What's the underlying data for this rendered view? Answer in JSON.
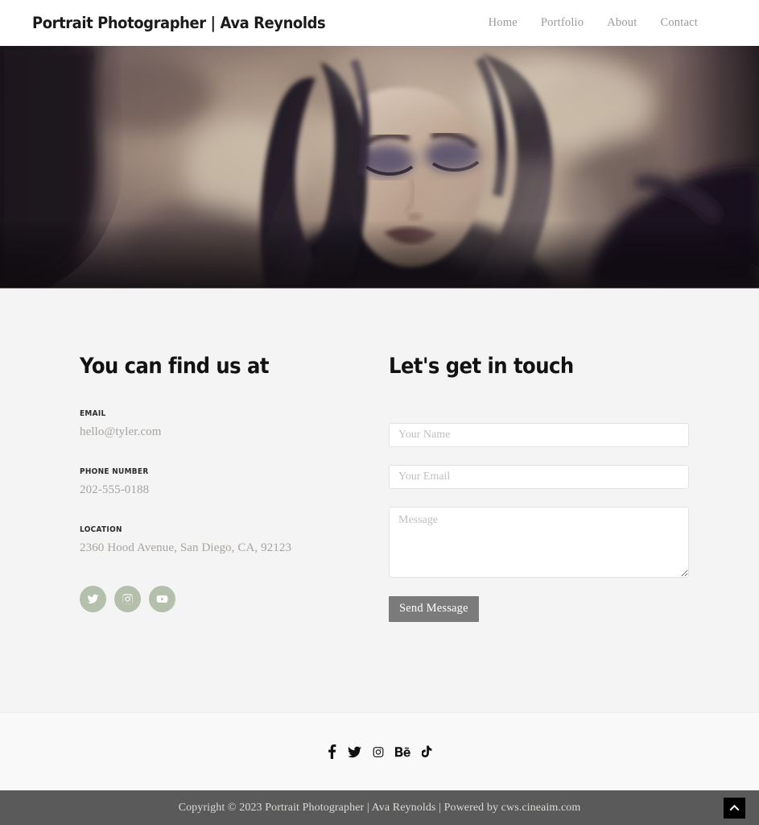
{
  "header": {
    "brand": "Portrait Photographer | Ava Reynolds",
    "nav": [
      {
        "label": "Home"
      },
      {
        "label": "Portfolio"
      },
      {
        "label": "About"
      },
      {
        "label": "Contact"
      }
    ]
  },
  "hero": {
    "alt": "Sepia-toned portrait photograph of a woman with long dark hair and dark eye makeup, eyes closed, surrounded by blurred foliage and dark feathers",
    "palette": {
      "highlight": "#cdb9a2",
      "midtone": "#8e7a6d",
      "shadow": "#3b2f33",
      "deep": "#1a1418"
    }
  },
  "contact": {
    "left": {
      "heading": "You can find us at",
      "items": [
        {
          "label": "EMAIL",
          "value": "hello@tyler.com"
        },
        {
          "label": "PHONE NUMBER",
          "value": "202-555-0188"
        },
        {
          "label": "LOCATION",
          "value": "2360 Hood Avenue, San Diego, CA, 92123"
        }
      ],
      "socials": [
        {
          "name": "twitter-icon",
          "title": "Twitter"
        },
        {
          "name": "instagram-icon",
          "title": "Instagram"
        },
        {
          "name": "youtube-icon",
          "title": "YouTube"
        }
      ],
      "social_circle_color": "#b4bfac"
    },
    "right": {
      "heading": "Let's get in touch",
      "name_placeholder": "Your Name",
      "name_value": "",
      "email_placeholder": "Your Email",
      "email_value": "",
      "message_placeholder": "Message",
      "message_value": "",
      "submit_label": "Send Message",
      "submit_color": "#7b7b7b"
    },
    "background": "#f4f4f4"
  },
  "footer": {
    "socials": [
      {
        "name": "facebook-icon",
        "title": "Facebook"
      },
      {
        "name": "twitter-icon",
        "title": "Twitter"
      },
      {
        "name": "instagram-icon",
        "title": "Instagram"
      },
      {
        "name": "behance-icon",
        "title": "Behance"
      },
      {
        "name": "tiktok-icon",
        "title": "TikTok"
      }
    ],
    "background": "#f9f9f9",
    "copyright": "Copyright © 2023 Portrait Photographer | Ava Reynolds | Powered by cws.cineaim.com",
    "copyright_background": "#5a5a5a",
    "back_to_top_title": "Back to top"
  }
}
